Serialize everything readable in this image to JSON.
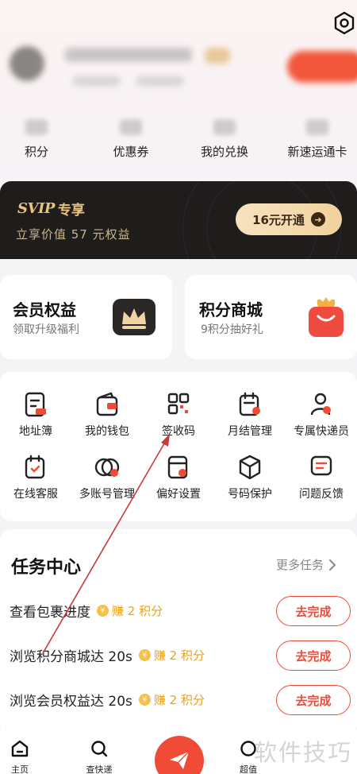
{
  "header": {
    "settings_icon": "gear-icon",
    "stats": [
      {
        "label": "积分"
      },
      {
        "label": "优惠券"
      },
      {
        "label": "我的兑换"
      },
      {
        "label": "新速运通卡"
      }
    ]
  },
  "svip": {
    "logo": "SVIP",
    "title": "专享",
    "subtitle": "立享价值 57 元权益",
    "button_label": "16元开通",
    "colors": {
      "bg": "#1f1d1c",
      "gold": "#e8c47c"
    }
  },
  "feature_cards": [
    {
      "title": "会员权益",
      "subtitle": "领取升级福利",
      "icon": "crown-icon"
    },
    {
      "title": "积分商城",
      "subtitle": "9积分抽好礼",
      "icon": "shopping-bag-icon"
    }
  ],
  "services": [
    {
      "label": "地址簿",
      "icon": "address-book-icon"
    },
    {
      "label": "我的钱包",
      "icon": "wallet-icon"
    },
    {
      "label": "签收码",
      "icon": "qr-code-icon"
    },
    {
      "label": "月结管理",
      "icon": "calendar-settings-icon"
    },
    {
      "label": "专属快递员",
      "icon": "courier-icon"
    },
    {
      "label": "在线客服",
      "icon": "customer-service-icon"
    },
    {
      "label": "多账号管理",
      "icon": "multi-account-icon"
    },
    {
      "label": "偏好设置",
      "icon": "preference-icon"
    },
    {
      "label": "号码保护",
      "icon": "shield-box-icon"
    },
    {
      "label": "问题反馈",
      "icon": "feedback-icon"
    }
  ],
  "tasks": {
    "title": "任务中心",
    "more_label": "更多任务",
    "items": [
      {
        "name": "查看包裹进度",
        "reward": "赚 2 积分",
        "button": "去完成"
      },
      {
        "name": "浏览积分商城达 20s",
        "reward": "赚 2 积分",
        "button": "去完成"
      },
      {
        "name": "浏览会员权益达 20s",
        "reward": "赚 2 积分",
        "button": "去完成"
      }
    ]
  },
  "tabbar": {
    "items": [
      {
        "label": "主页",
        "icon": "home-icon"
      },
      {
        "label": "查快递",
        "icon": "search-icon"
      },
      {
        "label": "",
        "icon": "send-icon"
      },
      {
        "label": "超值",
        "icon": "gift-icon"
      }
    ]
  },
  "watermark": "软件技巧",
  "accent_color": "#ef4b36"
}
